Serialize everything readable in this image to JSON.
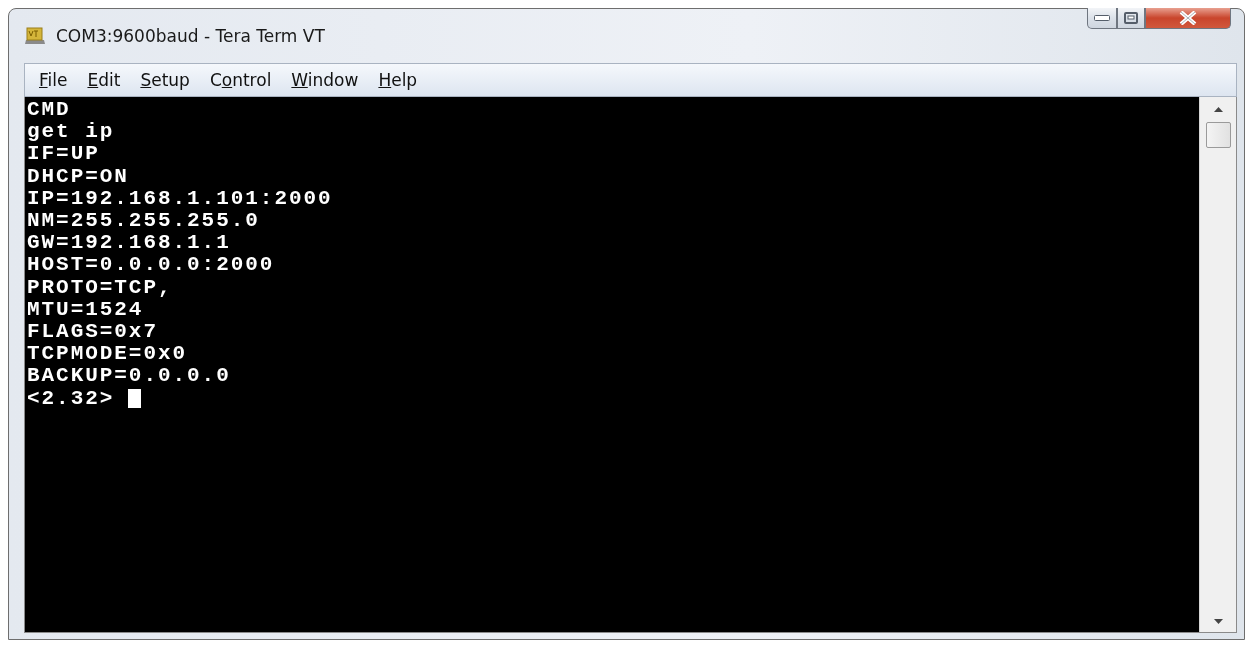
{
  "window": {
    "title": "COM3:9600baud - Tera Term VT"
  },
  "menu": [
    {
      "key": "F",
      "after": "ile"
    },
    {
      "key": "E",
      "after": "dit"
    },
    {
      "key": "S",
      "after": "etup"
    },
    {
      "before": "C",
      "key": "o",
      "after": "ntrol"
    },
    {
      "key": "W",
      "after": "indow"
    },
    {
      "key": "H",
      "after": "elp"
    }
  ],
  "terminal": {
    "lines": [
      "CMD",
      "get ip",
      "IF=UP",
      "DHCP=ON",
      "IP=192.168.1.101:2000",
      "NM=255.255.255.0",
      "GW=192.168.1.1",
      "HOST=0.0.0.0:2000",
      "PROTO=TCP,",
      "MTU=1524",
      "FLAGS=0x7",
      "TCPMODE=0x0",
      "BACKUP=0.0.0.0",
      "<2.32>"
    ],
    "cursor": true
  }
}
